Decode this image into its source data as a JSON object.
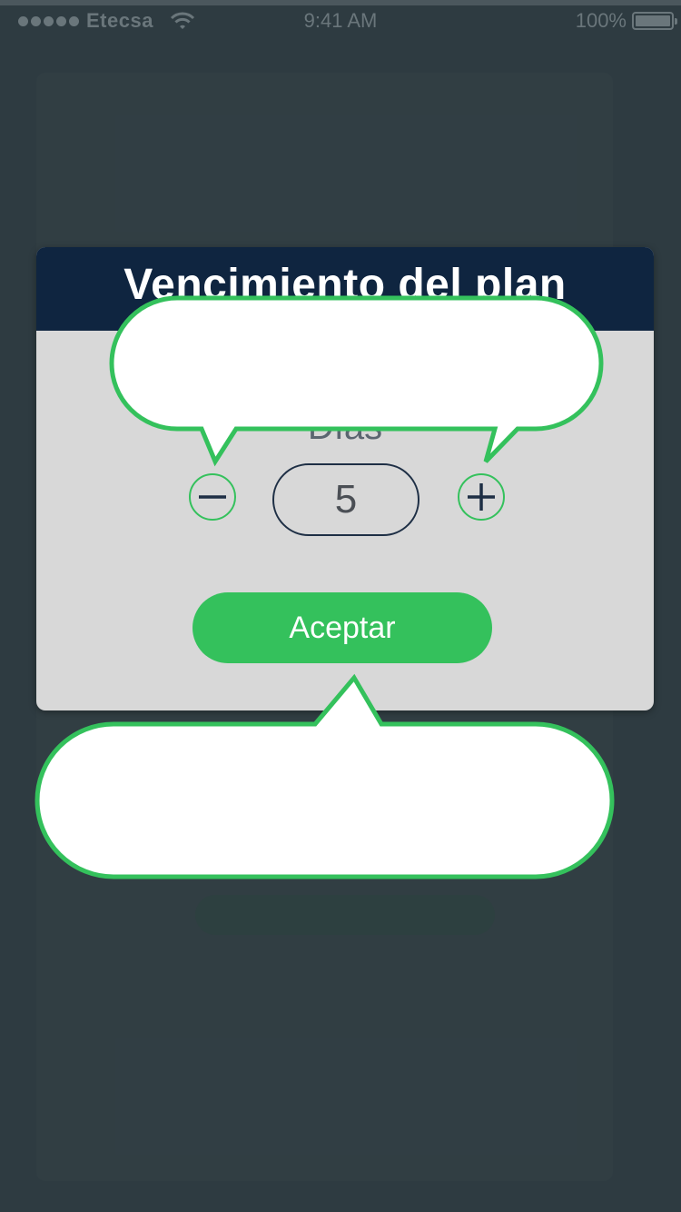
{
  "status_bar": {
    "carrier": "Etecsa",
    "time": "9:41 AM",
    "battery": "100%"
  },
  "dialog": {
    "title": "Vencimiento del plan",
    "days_label": "Días",
    "value": "5",
    "accept_label": "Aceptar"
  },
  "colors": {
    "background": "#2e3b41",
    "header": "#0f2540",
    "dialog_body": "#d8d8d8",
    "accent": "#34c15c"
  },
  "icons": {
    "decrement": "minus-icon",
    "increment": "plus-icon",
    "wifi": "wifi-icon",
    "battery": "battery-icon"
  }
}
